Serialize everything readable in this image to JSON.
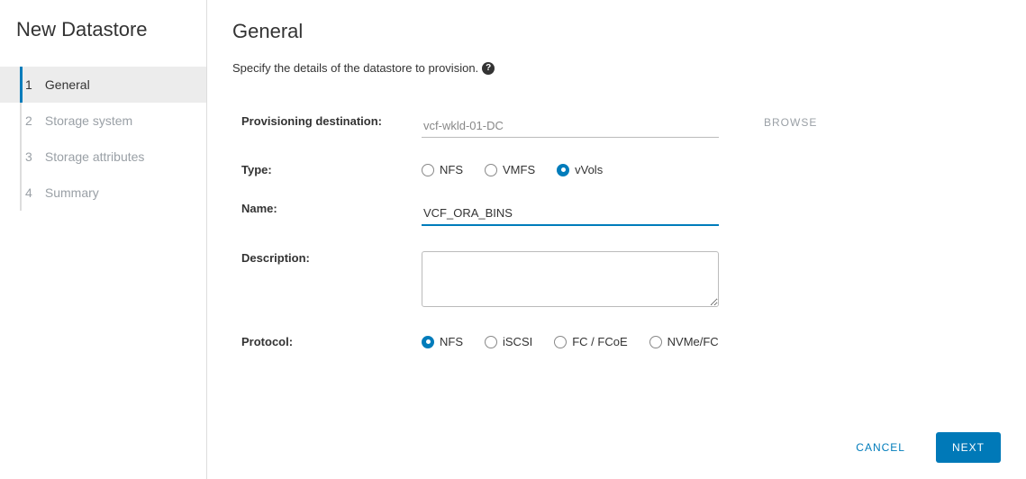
{
  "sidebar": {
    "title": "New Datastore",
    "steps": [
      {
        "num": "1",
        "label": "General",
        "active": true
      },
      {
        "num": "2",
        "label": "Storage system",
        "active": false
      },
      {
        "num": "3",
        "label": "Storage attributes",
        "active": false
      },
      {
        "num": "4",
        "label": "Summary",
        "active": false
      }
    ]
  },
  "main": {
    "title": "General",
    "subtitle": "Specify the details of the datastore to provision.",
    "labels": {
      "destination": "Provisioning destination:",
      "type": "Type:",
      "name": "Name:",
      "description": "Description:",
      "protocol": "Protocol:"
    },
    "fields": {
      "destination_value": "vcf-wkld-01-DC",
      "browse": "BROWSE",
      "type_options": [
        {
          "label": "NFS",
          "selected": false
        },
        {
          "label": "VMFS",
          "selected": false
        },
        {
          "label": "vVols",
          "selected": true
        }
      ],
      "name_value": "VCF_ORA_BINS",
      "description_value": "",
      "protocol_options": [
        {
          "label": "NFS",
          "selected": true
        },
        {
          "label": "iSCSI",
          "selected": false
        },
        {
          "label": "FC / FCoE",
          "selected": false
        },
        {
          "label": "NVMe/FC",
          "selected": false
        }
      ]
    }
  },
  "footer": {
    "cancel": "CANCEL",
    "next": "NEXT"
  }
}
